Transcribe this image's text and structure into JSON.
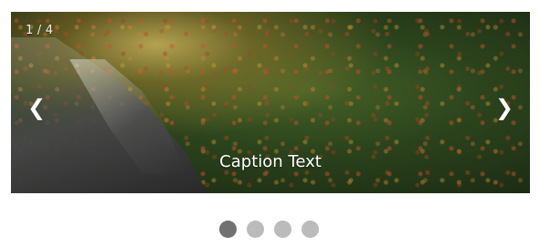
{
  "slideshow": {
    "counter_text": "1 / 4",
    "caption_text": "Caption Text",
    "prev_icon": "❮",
    "next_icon": "❯",
    "total_slides": 4,
    "current_slide": 1
  },
  "colors": {
    "active_dot": "#717171",
    "inactive_dot": "#bbbbbb",
    "text": "#ffffff"
  },
  "icons": {
    "previous": "chevron-left-icon",
    "next": "chevron-right-icon"
  }
}
